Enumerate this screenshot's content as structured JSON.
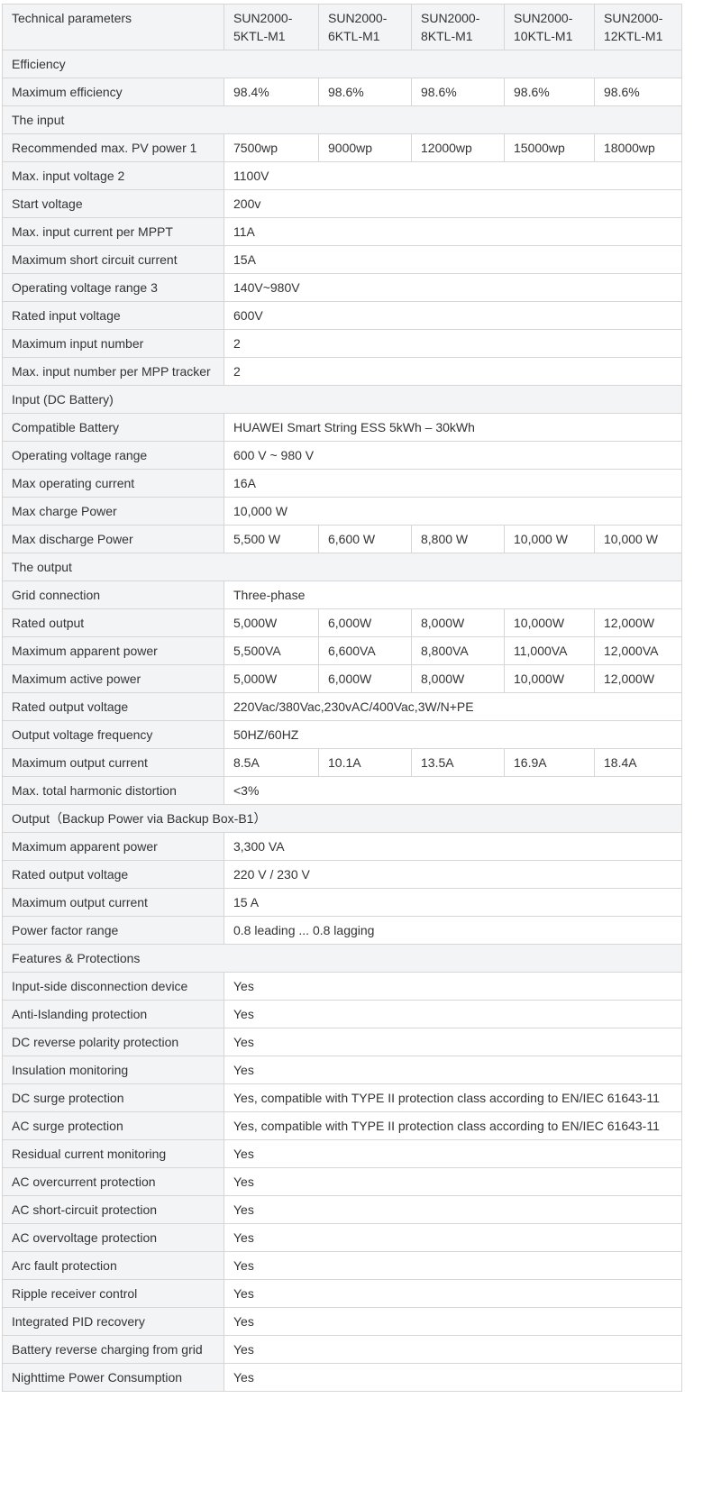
{
  "header": {
    "label": "Technical parameters",
    "models": [
      "SUN2000-5KTL-M1",
      "SUN2000-6KTL-M1",
      "SUN2000-8KTL-M1",
      "SUN2000-10KTL-M1",
      "SUN2000-12KTL-M1"
    ]
  },
  "rows": [
    {
      "section": "Efficiency"
    },
    {
      "label": "Maximum efficiency",
      "values": [
        "98.4%",
        "98.6%",
        "98.6%",
        "98.6%",
        "98.6%"
      ]
    },
    {
      "section": "The input"
    },
    {
      "label": "Recommended max. PV power 1",
      "values": [
        "7500wp",
        "9000wp",
        "12000wp",
        "15000wp",
        "18000wp"
      ]
    },
    {
      "label": "Max. input voltage 2",
      "values": [
        "1100V"
      ]
    },
    {
      "label": "Start voltage",
      "values": [
        "200v"
      ]
    },
    {
      "label": "Max. input current per MPPT",
      "values": [
        "11A"
      ]
    },
    {
      "label": "Maximum short circuit current",
      "values": [
        "15A"
      ]
    },
    {
      "label": "Operating voltage range 3",
      "values": [
        "140V~980V"
      ]
    },
    {
      "label": "Rated input voltage",
      "values": [
        "600V"
      ]
    },
    {
      "label": "Maximum input number",
      "values": [
        "2"
      ]
    },
    {
      "label": "Max. input number per MPP tracker",
      "values": [
        "2"
      ]
    },
    {
      "section": "Input (DC Battery)"
    },
    {
      "label": "Compatible Battery",
      "values": [
        "HUAWEI Smart String ESS 5kWh – 30kWh"
      ]
    },
    {
      "label": "Operating voltage range",
      "values": [
        "600 V ~ 980 V"
      ]
    },
    {
      "label": "Max operating current",
      "values": [
        "16A"
      ]
    },
    {
      "label": "Max charge Power",
      "values": [
        "10,000 W"
      ]
    },
    {
      "label": "Max discharge Power",
      "values": [
        "5,500 W",
        "6,600 W",
        "8,800 W",
        "10,000 W",
        "10,000 W"
      ]
    },
    {
      "section": "The output"
    },
    {
      "label": "Grid connection",
      "values": [
        "Three-phase"
      ]
    },
    {
      "label": "Rated output",
      "values": [
        "5,000W",
        "6,000W",
        "8,000W",
        "10,000W",
        "12,000W"
      ]
    },
    {
      "label": "Maximum apparent power",
      "values": [
        "5,500VA",
        "6,600VA",
        "8,800VA",
        "11,000VA",
        "12,000VA"
      ]
    },
    {
      "label": "Maximum active power",
      "values": [
        "5,000W",
        "6,000W",
        "8,000W",
        "10,000W",
        "12,000W"
      ]
    },
    {
      "label": "Rated output voltage",
      "values": [
        "220Vac/380Vac,230vAC/400Vac,3W/N+PE"
      ]
    },
    {
      "label": "Output voltage frequency",
      "values": [
        "50HZ/60HZ"
      ]
    },
    {
      "label": "Maximum output current",
      "values": [
        "8.5A",
        "10.1A",
        "13.5A",
        "16.9A",
        "18.4A"
      ]
    },
    {
      "label": "Max. total harmonic distortion",
      "values": [
        "<3%"
      ]
    },
    {
      "section": "Output（Backup Power via Backup Box-B1）"
    },
    {
      "label": "Maximum apparent power",
      "values": [
        "3,300 VA"
      ]
    },
    {
      "label": "Rated output voltage",
      "values": [
        "220 V / 230 V"
      ]
    },
    {
      "label": "Maximum output current",
      "values": [
        "15 A"
      ]
    },
    {
      "label": "Power factor range",
      "values": [
        "0.8 leading ... 0.8 lagging"
      ]
    },
    {
      "section": "Features & Protections"
    },
    {
      "label": "Input-side disconnection device",
      "values": [
        "Yes"
      ]
    },
    {
      "label": "Anti-Islanding protection",
      "values": [
        "Yes"
      ]
    },
    {
      "label": "DC reverse polarity protection",
      "values": [
        "Yes"
      ]
    },
    {
      "label": "Insulation monitoring",
      "values": [
        "Yes"
      ]
    },
    {
      "label": "DC surge protection",
      "values": [
        "Yes, compatible with TYPE II protection class according to EN/IEC 61643-11"
      ]
    },
    {
      "label": "AC surge protection",
      "values": [
        "Yes, compatible with TYPE II protection class according to EN/IEC 61643-11"
      ]
    },
    {
      "label": "Residual current monitoring",
      "values": [
        "Yes"
      ]
    },
    {
      "label": "AC overcurrent protection",
      "values": [
        "Yes"
      ]
    },
    {
      "label": "AC short-circuit protection",
      "values": [
        "Yes"
      ]
    },
    {
      "label": "AC overvoltage protection",
      "values": [
        "Yes"
      ]
    },
    {
      "label": "Arc fault protection",
      "values": [
        "Yes"
      ]
    },
    {
      "label": "Ripple receiver control",
      "values": [
        "Yes"
      ]
    },
    {
      "label": "Integrated PID recovery",
      "values": [
        "Yes"
      ]
    },
    {
      "label": "Battery reverse charging from grid",
      "values": [
        "Yes"
      ]
    },
    {
      "label": "Nighttime Power Consumption",
      "values": [
        "Yes"
      ]
    }
  ]
}
